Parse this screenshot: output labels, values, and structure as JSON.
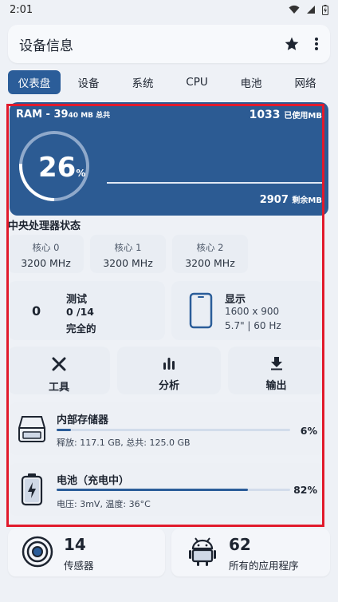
{
  "status": {
    "time": "2:01"
  },
  "topbar": {
    "title": "设备信息",
    "star_icon": "star-icon",
    "menu_icon": "more-vert-icon"
  },
  "tabs": [
    "仪表盘",
    "设备",
    "系统",
    "CPU",
    "电池",
    "网络"
  ],
  "ram": {
    "label": "RAM - 39",
    "total_small": "40 MB 总共",
    "used_value": "1033",
    "used_suffix": "已使用MB",
    "percent": "26",
    "percent_sign": "%",
    "percent_fraction": 0.26,
    "free_value": "2907",
    "free_suffix": "剩余MB"
  },
  "cpu_section_title": "中央处理器状态",
  "cores": [
    {
      "name": "核心 0",
      "freq": "3200 MHz"
    },
    {
      "name": "核心 1",
      "freq": "3200 MHz"
    },
    {
      "name": "核心 2",
      "freq": "3200 MHz"
    }
  ],
  "test": {
    "count": "0",
    "title": "测试",
    "ratio": "0 /14",
    "status": "完全的"
  },
  "display": {
    "title": "显示",
    "resolution": "1600 x 900",
    "detail": "5.7\" | 60 Hz"
  },
  "tools": [
    {
      "label": "工具",
      "icon": "tools-icon"
    },
    {
      "label": "分析",
      "icon": "analytics-icon"
    },
    {
      "label": "输出",
      "icon": "download-icon"
    }
  ],
  "storage": {
    "title": "内部存储器",
    "detail": "释放: 117.1 GB, 总共: 125.0 GB",
    "percent": "6%",
    "fraction": 0.06
  },
  "battery": {
    "title": "电池（充电中）",
    "detail": "电压: 3mV, 温度: 36°C",
    "percent": "82%",
    "fraction": 0.82
  },
  "sensors": {
    "count": "14",
    "label": "传感器"
  },
  "apps": {
    "count": "62",
    "label": "所有的应用程序"
  },
  "colors": {
    "accent": "#2b5d99",
    "highlight_border": "#e11a2c"
  }
}
